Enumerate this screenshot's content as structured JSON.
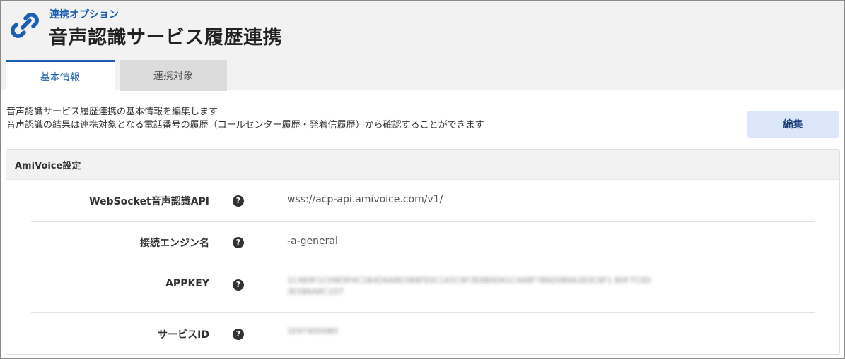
{
  "header": {
    "subtitle": "連携オプション",
    "title": "音声認識サービス履歴連携"
  },
  "tabs": [
    {
      "label": "基本情報",
      "active": true
    },
    {
      "label": "連携対象",
      "active": false
    }
  ],
  "description": {
    "line1": "音声認識サービス履歴連携の基本情報を編集します",
    "line2": "音声認識の結果は連携対象となる電話番号の履歴（コールセンター履歴・発着信履歴）から確認することができます"
  },
  "edit_button": {
    "label": "編集"
  },
  "section": {
    "title": "AmiVoice設定",
    "rows": [
      {
        "label": "WebSocket音声認識API",
        "value": "wss://acp-api.amivoice.com/v1/",
        "help": "?"
      },
      {
        "label": "接続エンジン名",
        "value": "-a-general",
        "help": "?"
      },
      {
        "label": "APPKEY",
        "value": "1C4B9F1C09E9F6C1B4D6A8D3B8FE0C1A5C9F3E8B0D61C4A8F7B6D0B9A3E0C8F1 B0F7C0D3E5B6A8C1D7",
        "help": "?"
      },
      {
        "label": "サービスID",
        "value": "1E9740D0B0",
        "help": "?"
      }
    ]
  },
  "colors": {
    "accent": "#1a5fb4",
    "header_bg": "#f2f2f2",
    "button_bg": "#dde7fb"
  },
  "icons": {
    "title_icon": "link-icon",
    "help_icon": "question-circle-icon"
  }
}
